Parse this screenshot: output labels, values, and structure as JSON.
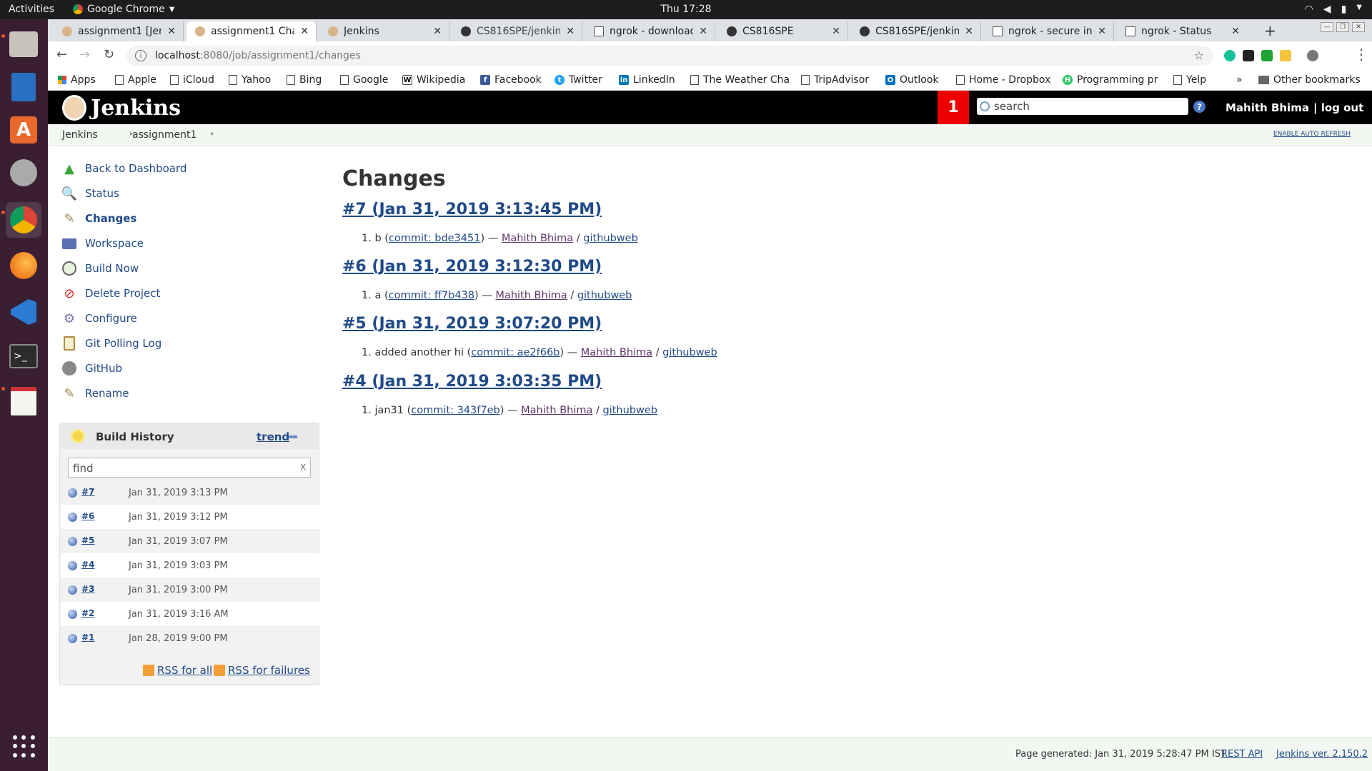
{
  "system": {
    "activities": "Activities",
    "app_name": "Google Chrome",
    "clock": "Thu 17:28"
  },
  "browser": {
    "tabs": [
      {
        "title": "assignment1 [Jen",
        "active": false
      },
      {
        "title": "assignment1 Char",
        "active": true
      },
      {
        "title": "Jenkins",
        "active": false
      },
      {
        "title": "CS816SPE/jenkins",
        "active": false
      },
      {
        "title": "ngrok - download",
        "active": false
      },
      {
        "title": "CS816SPE",
        "active": false
      },
      {
        "title": "CS816SPE/jenkins",
        "active": false
      },
      {
        "title": "ngrok - secure int",
        "active": false
      },
      {
        "title": "ngrok - Status",
        "active": false
      }
    ],
    "url_host": "localhost",
    "url_path": ":8080/job/assignment1/changes",
    "bookmarks": [
      "Apps",
      "Apple",
      "iCloud",
      "Yahoo",
      "Bing",
      "Google",
      "Wikipedia",
      "Facebook",
      "Twitter",
      "LinkedIn",
      "The Weather Cha",
      "TripAdvisor",
      "Outlook",
      "Home - Dropbox",
      "Programming pr",
      "Yelp"
    ],
    "more_bookmarks": "»",
    "other_bookmarks": "Other bookmarks"
  },
  "jenkins": {
    "brand": "Jenkins",
    "notification_count": "1",
    "search_placeholder": "search",
    "user": "Mahith Bhima",
    "logout": "| log out",
    "breadcrumb": [
      "Jenkins",
      "assignment1"
    ],
    "auto_refresh": "ENABLE AUTO REFRESH"
  },
  "sidebar": {
    "tasks": [
      {
        "label": "Back to Dashboard",
        "icon": "arrow-up-icon"
      },
      {
        "label": "Status",
        "icon": "magnifier-icon"
      },
      {
        "label": "Changes",
        "icon": "notepad-icon"
      },
      {
        "label": "Workspace",
        "icon": "folder-icon"
      },
      {
        "label": "Build Now",
        "icon": "clock-icon"
      },
      {
        "label": "Delete Project",
        "icon": "no-entry-icon"
      },
      {
        "label": "Configure",
        "icon": "gear-icon"
      },
      {
        "label": "Git Polling Log",
        "icon": "clipboard-icon"
      },
      {
        "label": "GitHub",
        "icon": "github-icon"
      },
      {
        "label": "Rename",
        "icon": "notepad-icon"
      }
    ]
  },
  "build_history": {
    "title": "Build History",
    "trend": "trend",
    "find_placeholder": "find",
    "find_clear": "x",
    "builds": [
      {
        "num": "#7",
        "date": "Jan 31, 2019 3:13 PM"
      },
      {
        "num": "#6",
        "date": "Jan 31, 2019 3:12 PM"
      },
      {
        "num": "#5",
        "date": "Jan 31, 2019 3:07 PM"
      },
      {
        "num": "#4",
        "date": "Jan 31, 2019 3:03 PM"
      },
      {
        "num": "#3",
        "date": "Jan 31, 2019 3:00 PM"
      },
      {
        "num": "#2",
        "date": "Jan 31, 2019 3:16 AM"
      },
      {
        "num": "#1",
        "date": "Jan 28, 2019 9:00 PM"
      }
    ],
    "rss_all": "RSS for all",
    "rss_failures": "RSS for failures"
  },
  "main": {
    "title": "Changes",
    "builds": [
      {
        "heading": "#7 (Jan 31, 2019 3:13:45 PM)",
        "msg": "b",
        "commit": "commit: bde3451",
        "author": "Mahith Bhima",
        "web": "githubweb"
      },
      {
        "heading": "#6 (Jan 31, 2019 3:12:30 PM)",
        "msg": "a",
        "commit": "commit: ff7b438",
        "author": "Mahith Bhima",
        "web": "githubweb"
      },
      {
        "heading": "#5 (Jan 31, 2019 3:07:20 PM)",
        "msg": "added another hi",
        "commit": "commit: ae2f66b",
        "author": "Mahith Bhima",
        "web": "githubweb"
      },
      {
        "heading": "#4 (Jan 31, 2019 3:03:35 PM)",
        "msg": "jan31",
        "commit": "commit: 343f7eb",
        "author": "Mahith Bhima",
        "web": "githubweb"
      }
    ]
  },
  "footer": {
    "generated": "Page generated: Jan 31, 2019 5:28:47 PM IST",
    "rest_api": "REST API",
    "version": "Jenkins ver. 2.150.2"
  }
}
